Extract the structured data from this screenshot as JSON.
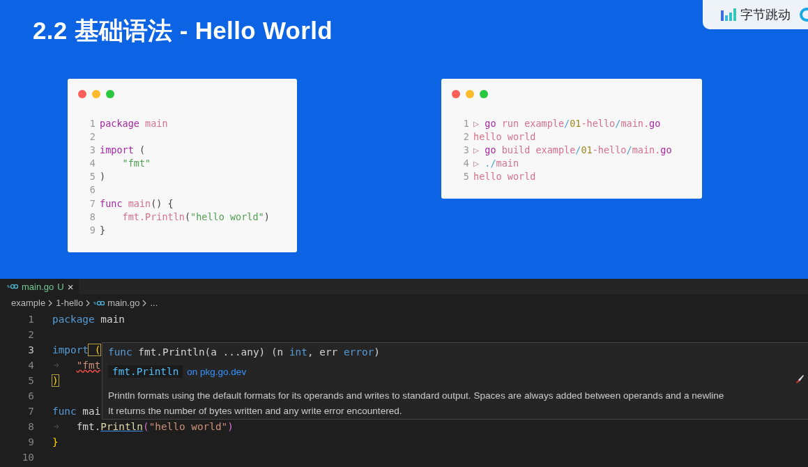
{
  "slide": {
    "title": "2.2 基础语法 - Hello World",
    "logo": {
      "text": "字节跳动"
    }
  },
  "cards": [
    {
      "lines": [
        {
          "number": "1",
          "tokens": [
            {
              "text": "package",
              "kind": "keyword"
            },
            {
              "text": " main",
              "kind": "ident"
            }
          ]
        },
        {
          "number": "2"
        },
        {
          "number": "3",
          "tokens": [
            {
              "text": "import",
              "kind": "keyword"
            },
            {
              "text": " (",
              "kind": "plain"
            }
          ]
        },
        {
          "number": "4",
          "tokens": [
            {
              "text": "    \"fmt\"",
              "kind": "string"
            }
          ]
        },
        {
          "number": "5",
          "tokens": [
            {
              "text": ")",
              "kind": "plain"
            }
          ]
        },
        {
          "number": "6"
        },
        {
          "number": "7",
          "tokens": [
            {
              "text": "func",
              "kind": "keyword"
            },
            {
              "text": " main",
              "kind": "ident"
            },
            {
              "text": "() {",
              "kind": "plain"
            }
          ]
        },
        {
          "number": "8",
          "tokens": [
            {
              "text": "    fmt.Println",
              "kind": "ident"
            },
            {
              "text": "(",
              "kind": "plain"
            },
            {
              "text": "\"hello world\"",
              "kind": "string"
            },
            {
              "text": ")",
              "kind": "plain"
            }
          ]
        },
        {
          "number": "9",
          "tokens": [
            {
              "text": "}",
              "kind": "plain"
            }
          ]
        }
      ]
    },
    {
      "lines": [
        {
          "number": "1",
          "tokens": [
            {
              "text": "▷ ",
              "kind": "prompt"
            },
            {
              "text": "go",
              "kind": "keyword"
            },
            {
              "text": " run example",
              "kind": "ident"
            },
            {
              "text": "/",
              "kind": "slash"
            },
            {
              "text": "01",
              "kind": "number"
            },
            {
              "text": "-hello",
              "kind": "ident"
            },
            {
              "text": "/",
              "kind": "slash"
            },
            {
              "text": "main.",
              "kind": "ident"
            },
            {
              "text": "go",
              "kind": "keyword"
            }
          ]
        },
        {
          "number": "2",
          "tokens": [
            {
              "text": "hello world",
              "kind": "ident"
            }
          ]
        },
        {
          "number": "3",
          "tokens": [
            {
              "text": "▷ ",
              "kind": "prompt"
            },
            {
              "text": "go",
              "kind": "keyword"
            },
            {
              "text": " build example",
              "kind": "ident"
            },
            {
              "text": "/",
              "kind": "slash"
            },
            {
              "text": "01",
              "kind": "number"
            },
            {
              "text": "-hello",
              "kind": "ident"
            },
            {
              "text": "/",
              "kind": "slash"
            },
            {
              "text": "main.",
              "kind": "ident"
            },
            {
              "text": "go",
              "kind": "keyword"
            }
          ]
        },
        {
          "number": "4",
          "tokens": [
            {
              "text": "▷ ",
              "kind": "prompt"
            },
            {
              "text": "./",
              "kind": "slash"
            },
            {
              "text": "main",
              "kind": "ident"
            }
          ]
        },
        {
          "number": "5",
          "tokens": [
            {
              "text": "hello world",
              "kind": "ident"
            }
          ]
        }
      ]
    }
  ],
  "editor": {
    "tab": {
      "label": "main.go",
      "status": "U",
      "close": "×",
      "selected": true
    },
    "breadcrumb": [
      "example",
      "1-hello",
      "main.go",
      "..."
    ],
    "lines": [
      {
        "number": "1",
        "indent_marker": false,
        "tokens": [
          {
            "text": "package",
            "kind": "keyword"
          },
          {
            "text": " main",
            "kind": "plain"
          }
        ]
      },
      {
        "number": "2",
        "indent_marker": false
      },
      {
        "number": "3",
        "indent_marker": false,
        "tokens": [
          {
            "text": "import",
            "kind": "keyword"
          },
          {
            "text": " (",
            "kind": "bracket-match"
          }
        ]
      },
      {
        "number": "4",
        "indent_marker": true,
        "tokens": [
          {
            "text": "\"fmt",
            "kind": "string-error"
          }
        ]
      },
      {
        "number": "5",
        "indent_marker": false,
        "tokens": [
          {
            "text": ")",
            "kind": "bracket-match"
          }
        ]
      },
      {
        "number": "6",
        "indent_marker": false
      },
      {
        "number": "7",
        "indent_marker": false,
        "tokens": [
          {
            "text": "func",
            "kind": "keyword"
          },
          {
            "text": " mai",
            "kind": "plain"
          }
        ]
      },
      {
        "number": "8",
        "indent_marker": true,
        "tokens": [
          {
            "text": "fmt.",
            "kind": "plain"
          },
          {
            "text": "Println",
            "kind": "link"
          },
          {
            "text": "(",
            "kind": "paren"
          },
          {
            "text": "\"hello world\"",
            "kind": "string"
          },
          {
            "text": ")",
            "kind": "paren"
          }
        ]
      },
      {
        "number": "9",
        "indent_marker": false,
        "tokens": [
          {
            "text": "}",
            "kind": "brace"
          }
        ]
      },
      {
        "number": "10",
        "indent_marker": false
      }
    ],
    "hover": {
      "signature": [
        {
          "text": "func",
          "kind": "keyword"
        },
        {
          "text": " fmt.Println(a ...any) (n ",
          "kind": "plain"
        },
        {
          "text": "int",
          "kind": "keyword"
        },
        {
          "text": ", err ",
          "kind": "plain"
        },
        {
          "text": "error",
          "kind": "keyword"
        },
        {
          "text": ")",
          "kind": "plain"
        }
      ],
      "symbol": "fmt.Println",
      "link": "on pkg.go.dev",
      "doc": [
        "Println formats using the default formats for its operands and writes to standard output. Spaces are always added between operands and a newline",
        "It returns the number of bytes written and any write error encountered."
      ]
    }
  }
}
